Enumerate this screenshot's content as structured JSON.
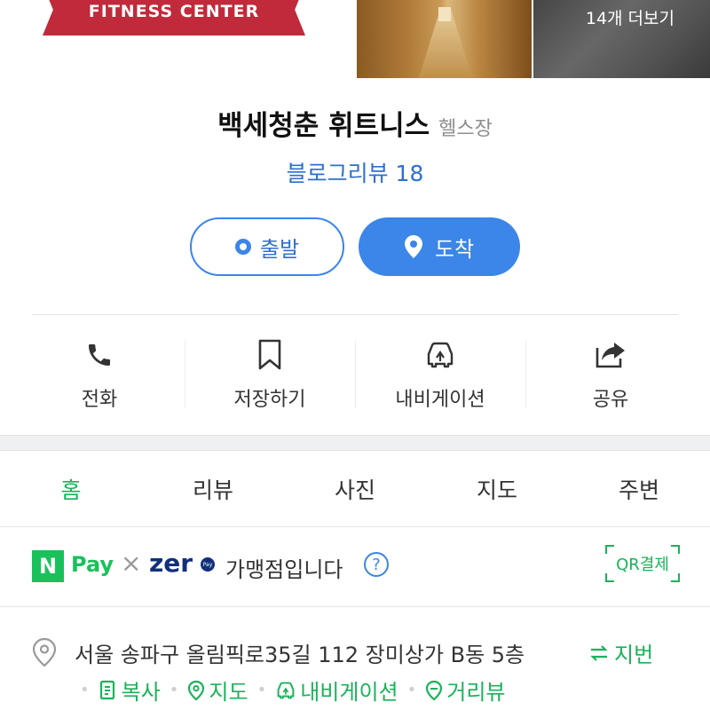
{
  "header": {
    "logo_text": "FITNESS CENTER",
    "more_photos": "14개 더보기"
  },
  "place": {
    "name": "백세청춘 휘트니스",
    "category": "헬스장",
    "blog_review": "블로그리뷰 18"
  },
  "route": {
    "depart_label": "출발",
    "arrive_label": "도착"
  },
  "actions": [
    {
      "label": "전화",
      "icon": "phone-icon"
    },
    {
      "label": "저장하기",
      "icon": "bookmark-icon"
    },
    {
      "label": "내비게이션",
      "icon": "car-icon"
    },
    {
      "label": "공유",
      "icon": "share-icon"
    }
  ],
  "tabs": [
    {
      "label": "홈",
      "active": true
    },
    {
      "label": "리뷰"
    },
    {
      "label": "사진"
    },
    {
      "label": "지도"
    },
    {
      "label": "주변"
    }
  ],
  "pay": {
    "npay_logo": "N",
    "pay_word": "Pay",
    "times": "×",
    "zero_word": "zer",
    "zero_badge": "Pay",
    "member_text": "가맹점입니다",
    "help": "?",
    "qr_label": "QR결제"
  },
  "address": {
    "text": "서울 송파구 올림픽로35길 112 장미상가 B동 5층",
    "jibun": "지번",
    "links": [
      {
        "label": "복사",
        "icon": "copy-icon"
      },
      {
        "label": "지도",
        "icon": "map-pin-icon"
      },
      {
        "label": "내비게이션",
        "icon": "car-icon"
      },
      {
        "label": "거리뷰",
        "icon": "streetview-icon"
      }
    ]
  },
  "colors": {
    "accent_blue": "#3b86e8",
    "accent_green": "#19b35a"
  }
}
